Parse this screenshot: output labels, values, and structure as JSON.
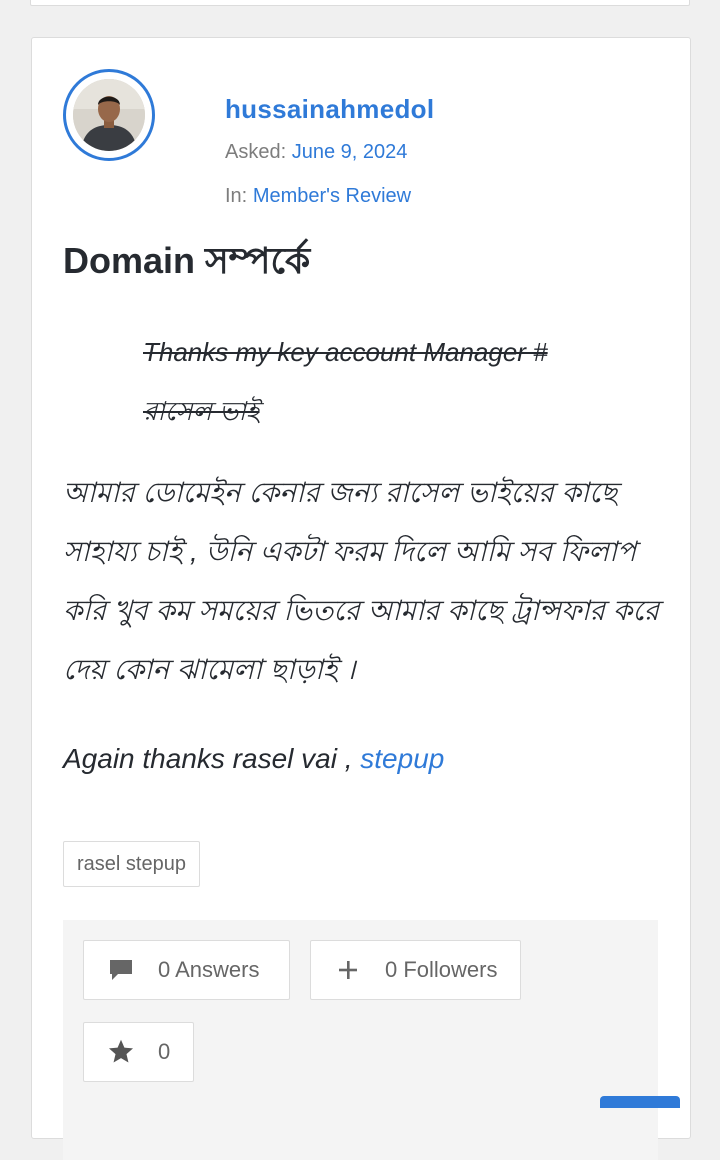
{
  "question": {
    "author": "hussainahmedol",
    "asked_label": "Asked:",
    "asked_date": "June 9, 2024",
    "in_label": "In:",
    "category": "Member's Review",
    "title": "Domain সম্পর্কে",
    "strikethrough_text": "Thanks  my key account Manager # রাসেল ভাই",
    "body_paragraph": "আমার ডোমেইন কেনার জন্য রাসেল ভাইয়ের কাছে সাহায্য চাই , উনি একটা ফরম দিলে আমি সব ফিলাপ করি খুব কম সময়ের ভিতরে আমার কাছে ট্রান্সফার করে দেয় কোন ঝামেলা ছাড়াই ।",
    "thanks_text": "Again thanks rasel  vai ,",
    "thanks_link": "stepup",
    "tag": "rasel stepup"
  },
  "actions": {
    "answers_label": "0 Answers",
    "followers_label": "0 Followers",
    "star_count": "0"
  },
  "icons": {
    "answers": "comment-icon",
    "followers": "plus-icon",
    "favorite": "star-icon"
  },
  "colors": {
    "accent": "#2f7ad8",
    "text": "#262a30",
    "muted": "#7d7d7d",
    "background": "#f0f0f0"
  }
}
